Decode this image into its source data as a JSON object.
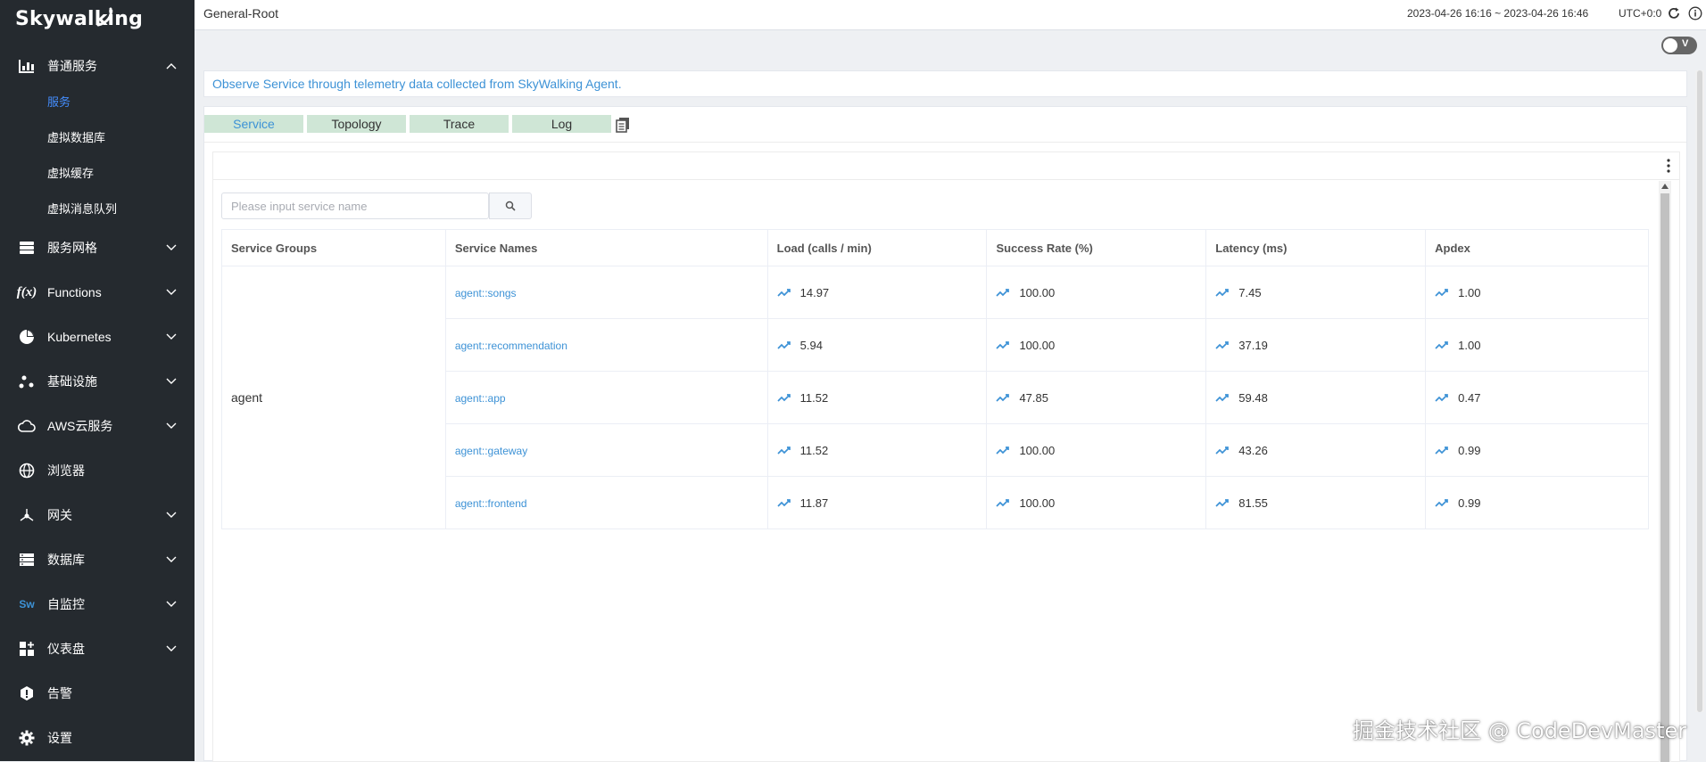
{
  "brand": {
    "logo_text": "Skywalking"
  },
  "sidebar": {
    "items": [
      {
        "label": "普通服务",
        "icon": "bar-chart-icon",
        "expanded": true,
        "children": [
          "服务",
          "虚拟数据库",
          "虚拟缓存",
          "虚拟消息队列"
        ],
        "active_child": "服务"
      },
      {
        "label": "服务网格",
        "icon": "database-icon"
      },
      {
        "label": "Functions",
        "icon": "function-icon"
      },
      {
        "label": "Kubernetes",
        "icon": "pie-chart-icon"
      },
      {
        "label": "基础设施",
        "icon": "nodes-icon"
      },
      {
        "label": "AWS云服务",
        "icon": "cloud-icon"
      },
      {
        "label": "浏览器",
        "icon": "globe-icon"
      },
      {
        "label": "网关",
        "icon": "gateway-icon"
      },
      {
        "label": "数据库",
        "icon": "server-icon"
      },
      {
        "label": "自监控",
        "icon": "skywalking-icon"
      },
      {
        "label": "仪表盘",
        "icon": "dashboard-icon"
      },
      {
        "label": "告警",
        "icon": "alert-icon"
      },
      {
        "label": "设置",
        "icon": "gear-icon"
      }
    ]
  },
  "header": {
    "breadcrumb": "General-Root",
    "time_range": "2023-04-26 16:16 ~ 2023-04-26 16:46",
    "timezone": "UTC+0:0"
  },
  "toggle": {
    "label": "V",
    "on": false
  },
  "description": "Observe Service through telemetry data collected from SkyWalking Agent.",
  "tabs": [
    {
      "label": "Service",
      "active": true
    },
    {
      "label": "Topology",
      "active": false
    },
    {
      "label": "Trace",
      "active": false
    },
    {
      "label": "Log",
      "active": false
    }
  ],
  "search": {
    "placeholder": "Please input service name",
    "value": ""
  },
  "table": {
    "columns": [
      "Service Groups",
      "Service Names",
      "Load (calls / min)",
      "Success Rate (%)",
      "Latency (ms)",
      "Apdex"
    ],
    "group": "agent",
    "rows": [
      {
        "name": "agent::songs",
        "load": "14.97",
        "success": "100.00",
        "latency": "7.45",
        "apdex": "1.00"
      },
      {
        "name": "agent::recommendation",
        "load": "5.94",
        "success": "100.00",
        "latency": "37.19",
        "apdex": "1.00"
      },
      {
        "name": "agent::app",
        "load": "11.52",
        "success": "47.85",
        "latency": "59.48",
        "apdex": "0.47"
      },
      {
        "name": "agent::gateway",
        "load": "11.52",
        "success": "100.00",
        "latency": "43.26",
        "apdex": "0.99"
      },
      {
        "name": "agent::frontend",
        "load": "11.87",
        "success": "100.00",
        "latency": "81.55",
        "apdex": "0.99"
      }
    ]
  },
  "colors": {
    "sidebar_bg": "#252a2f",
    "accent": "#3d92d6",
    "tab_bg": "#cfe6d6",
    "active_menu": "#448dfe"
  },
  "watermark": "掘金技术社区 @ CodeDevMaster"
}
